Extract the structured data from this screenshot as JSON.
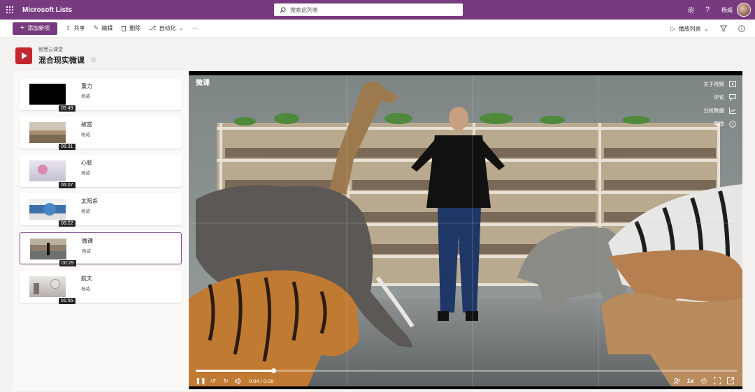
{
  "app": {
    "title": "Microsoft Lists",
    "search_placeholder": "搜索此列表",
    "user_name": "杨威"
  },
  "commandbar": {
    "new_item": "添加新项",
    "share": "共享",
    "edit": "编辑",
    "delete": "删除",
    "automate": "自动化",
    "more": "···",
    "view": "播放列表"
  },
  "list": {
    "site_name": "智慧云课堂",
    "title": "混合现实微课"
  },
  "cards": [
    {
      "title": "重力",
      "author": "杨威",
      "duration": "05:49"
    },
    {
      "title": "故宫",
      "author": "杨威",
      "duration": "06:31"
    },
    {
      "title": "心脏",
      "author": "杨威",
      "duration": "06:07"
    },
    {
      "title": "太阳系",
      "author": "杨威",
      "duration": "06:22"
    },
    {
      "title": "微课",
      "author": "杨威",
      "duration": "00:29"
    },
    {
      "title": "航天",
      "author": "杨威",
      "duration": "01:55"
    }
  ],
  "player": {
    "title": "微课",
    "menu": {
      "about": "关于视频",
      "comments": "评论",
      "analytics": "分析数据",
      "help": "帮助"
    },
    "time": "0:04 / 0:28",
    "progress_fraction": 0.143,
    "speed": "1x"
  },
  "colors": {
    "brand": "#773a7f",
    "list_icon": "#c4262e",
    "selected_border": "#8e5596"
  }
}
